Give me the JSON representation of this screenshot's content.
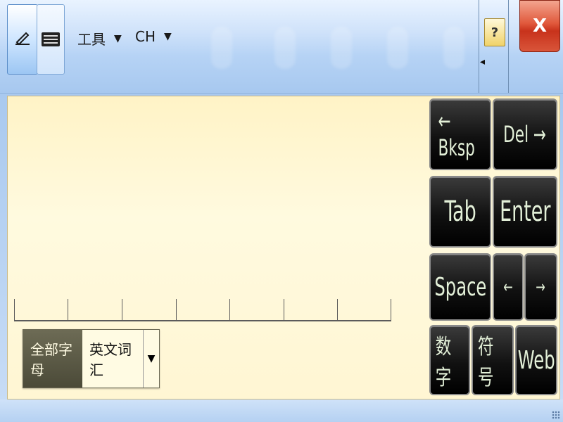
{
  "toolbar": {
    "pen_icon": "pen-writing-icon",
    "keyboard_icon": "keyboard-icon",
    "tools_label": "工具",
    "language_label": "CH",
    "caret": "▼",
    "help_label": "?",
    "dock_arrow": "◂",
    "close_label": "X"
  },
  "mode": {
    "selected": "全部字母",
    "other": "英文词汇",
    "dropdown": "▼"
  },
  "keys": {
    "bksp": "← Bksp",
    "del": "Del →",
    "tab": "Tab",
    "enter": "Enter",
    "space": "Space",
    "left": "←",
    "right": "→",
    "numbers": "数字",
    "symbols": "符号",
    "web": "Web"
  },
  "colors": {
    "pad_bg": "#fff8d8",
    "key_bg": "#111111",
    "key_text": "#e3f0d8",
    "close_bg": "#d9553a"
  }
}
